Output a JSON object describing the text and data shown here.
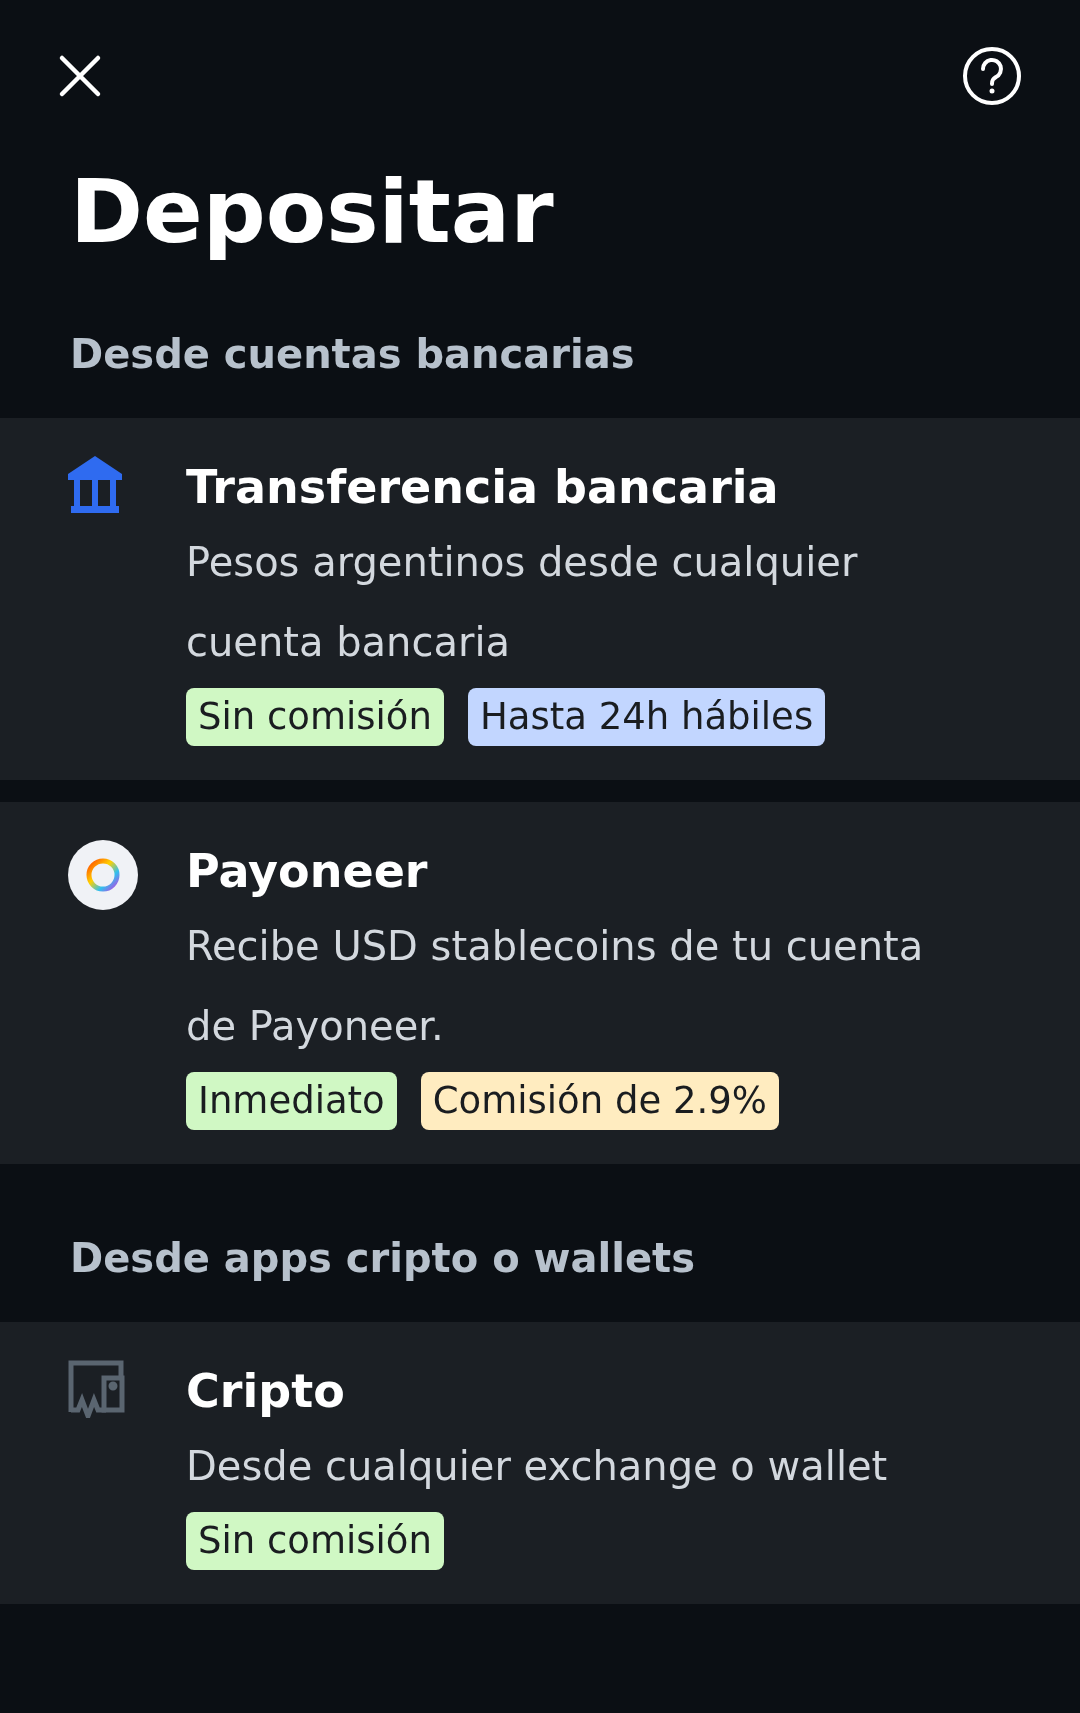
{
  "header": {
    "title": "Depositar"
  },
  "sections": [
    {
      "heading": "Desde cuentas bancarias",
      "methods": [
        {
          "kind": "bank",
          "title": "Transferencia bancaria",
          "description": "Pesos argentinos desde cualquier cuenta bancaria",
          "tags": [
            {
              "label": "Sin comisión",
              "color": "#d0f8c4"
            },
            {
              "label": "Hasta 24h hábiles",
              "color": "#c2d6ff"
            }
          ]
        },
        {
          "kind": "payoneer",
          "title": "Payoneer",
          "description": "Recibe USD stablecoins de tu cuenta de Payoneer.",
          "tags": [
            {
              "label": "Inmediato",
              "color": "#d0f8c4"
            },
            {
              "label": "Comisión de 2.9%",
              "color": "#ffecc0"
            }
          ]
        }
      ]
    },
    {
      "heading": "Desde apps cripto o wallets",
      "methods": [
        {
          "kind": "crypto",
          "title": "Cripto",
          "description": "Desde cualquier exchange o wallet",
          "tags": [
            {
              "label": "Sin comisión",
              "color": "#d0f8c4"
            }
          ]
        }
      ]
    }
  ]
}
